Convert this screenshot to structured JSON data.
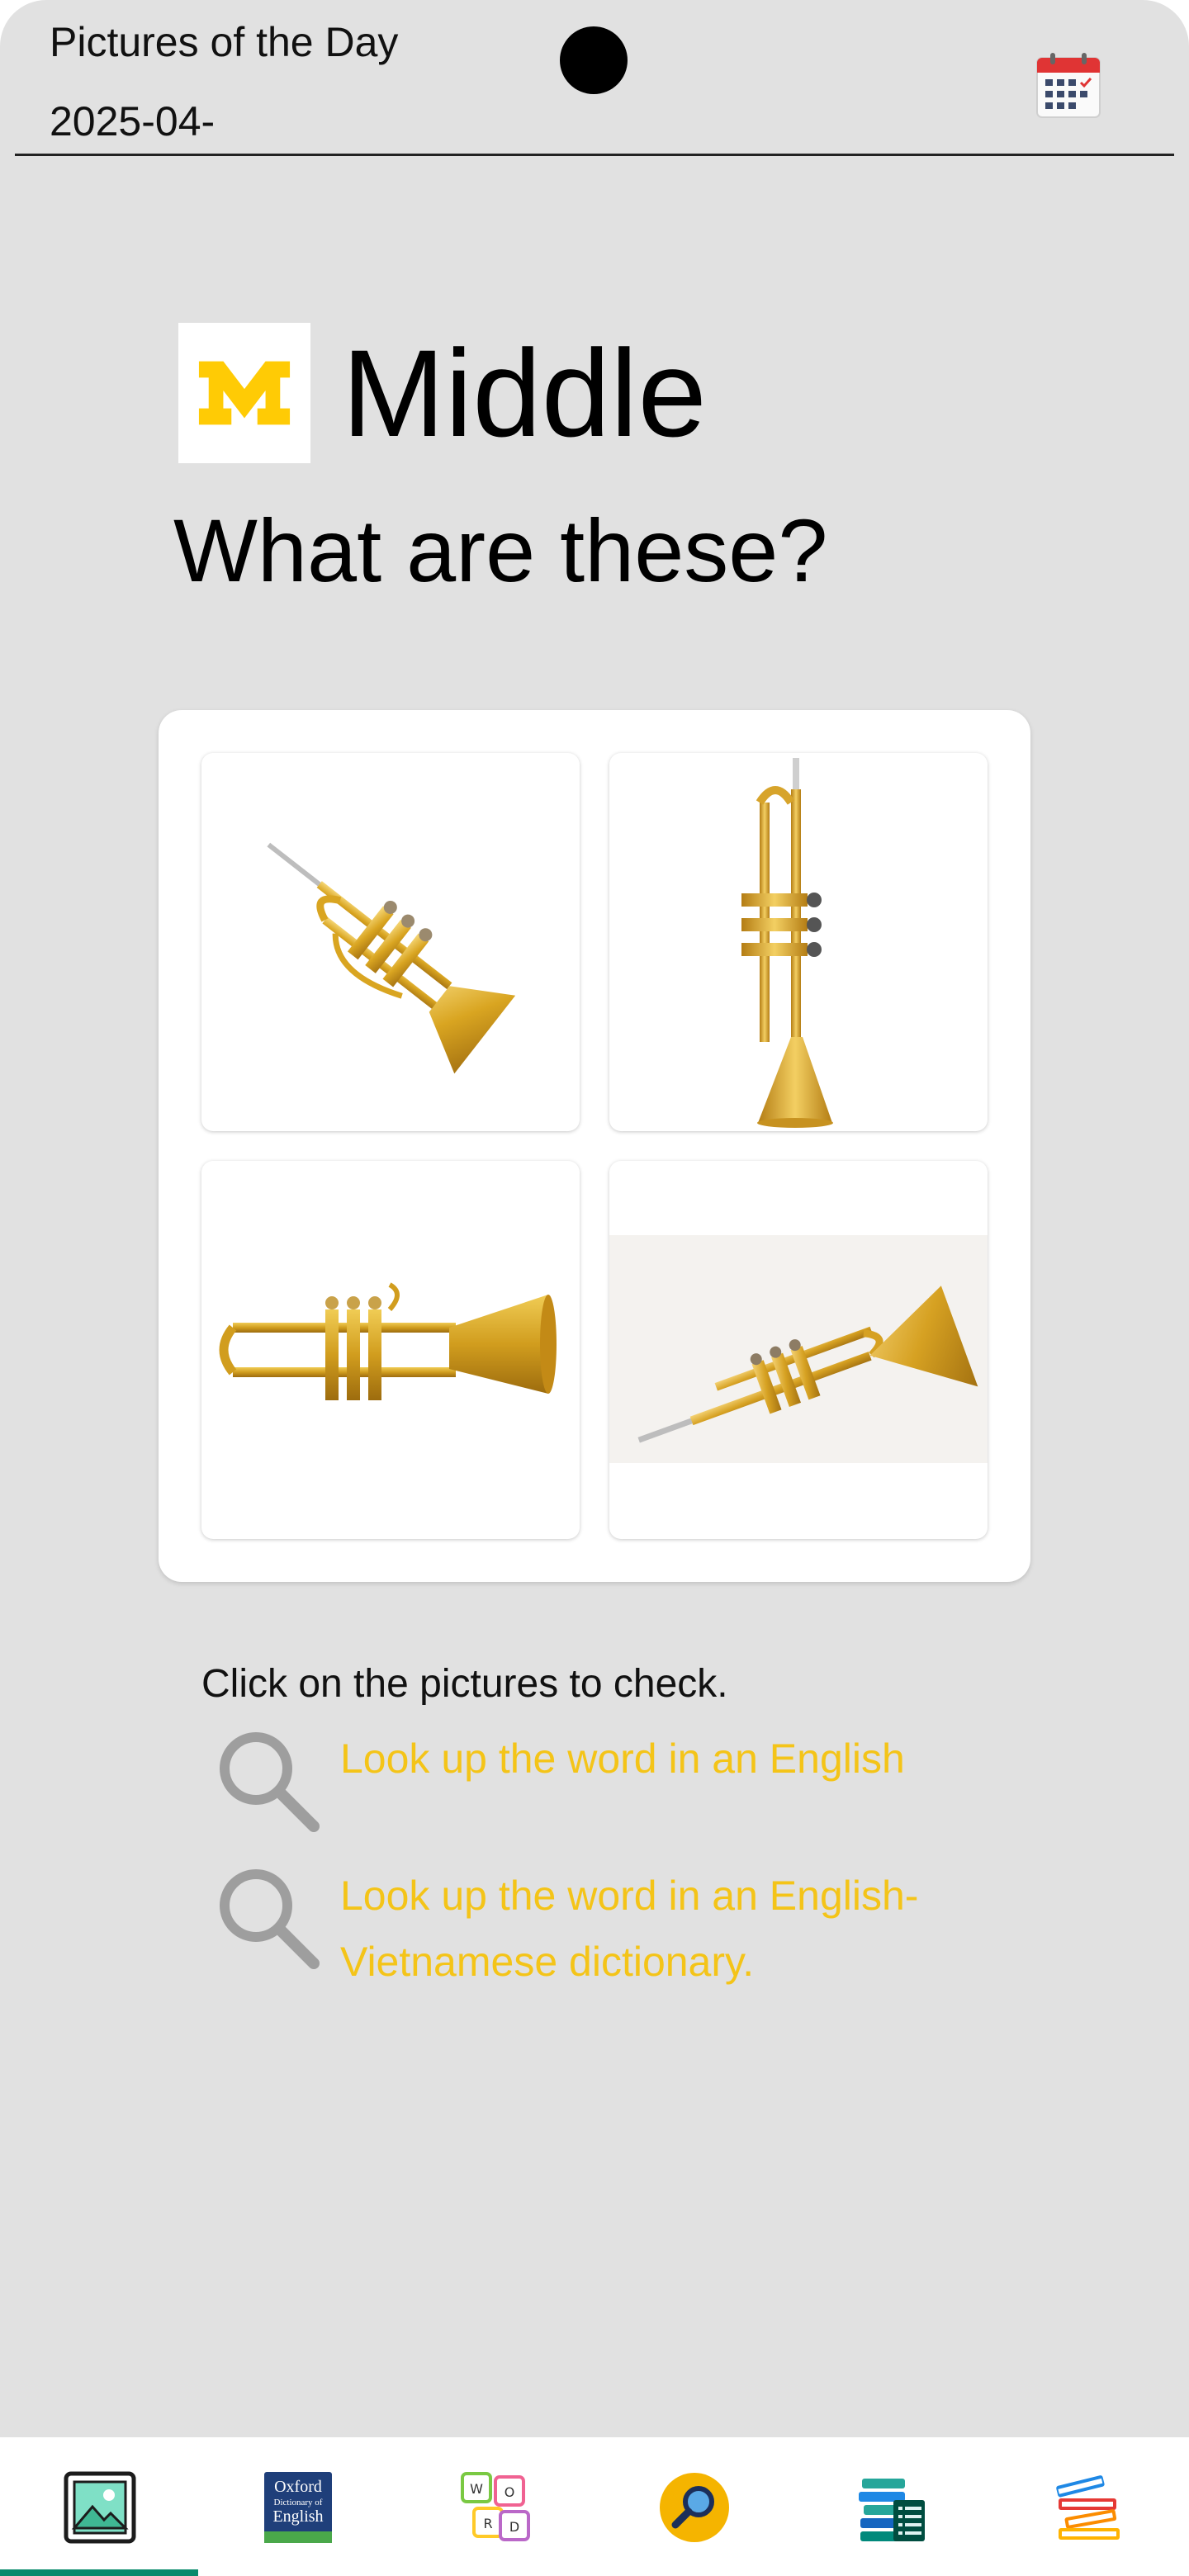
{
  "header": {
    "title": "Pictures of the Day",
    "date": "2025-04-",
    "calendar_icon": "calendar-icon"
  },
  "level": {
    "logo_icon": "block-m-logo",
    "label": "Middle"
  },
  "question": "What are these?",
  "pictures": [
    {
      "icon": "trumpet-diagonal-image"
    },
    {
      "icon": "trumpet-vertical-image"
    },
    {
      "icon": "trumpet-horizontal-image"
    },
    {
      "icon": "trumpet-angled-image"
    }
  ],
  "instruction": "Click on the pictures to check.",
  "lookups": [
    {
      "label": "Look up the word in an English",
      "icon": "magnifier-icon"
    },
    {
      "label": "Look up the word in an English-Vietnamese dictionary.",
      "icon": "magnifier-icon"
    }
  ],
  "colors": {
    "background": "#e1e1e1",
    "link_yellow": "#f4c418",
    "nav_indicator": "#0a8a6c",
    "logo_maize": "#ffcb05"
  },
  "bottom_nav": [
    {
      "name": "pictures",
      "icon": "picture-icon",
      "active": true
    },
    {
      "name": "oxford",
      "icon": "oxford-dictionary-icon",
      "logo_lines": [
        "Oxford",
        "Dictionary of",
        "English"
      ]
    },
    {
      "name": "word",
      "icon": "word-tiles-icon",
      "tiles": [
        "W",
        "O",
        "R",
        "D"
      ]
    },
    {
      "name": "search",
      "icon": "search-icon"
    },
    {
      "name": "books-list",
      "icon": "books-list-icon"
    },
    {
      "name": "books",
      "icon": "books-stack-icon"
    }
  ]
}
